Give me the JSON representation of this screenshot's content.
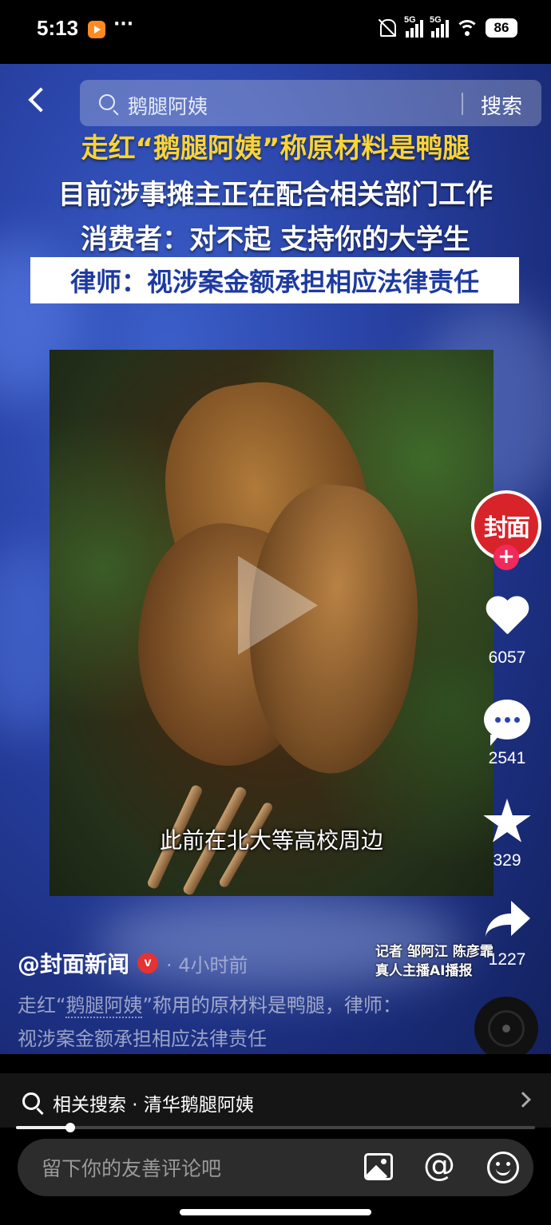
{
  "status_bar": {
    "time": "5:13",
    "dots": "···",
    "signal1_label": "5G",
    "signal2_label": "5G",
    "battery": "86"
  },
  "search": {
    "query": "鹅腿阿姨",
    "button": "搜索"
  },
  "headlines": {
    "line1": "走红“鹅腿阿姨”称原材料是鸭腿",
    "line2": "目前涉事摊主正在配合相关部门工作",
    "line3": "消费者：对不起 支持你的大学生",
    "line4": "律师：视涉案金额承担相应法律责任"
  },
  "video": {
    "subtitle": "此前在北大等高校周边"
  },
  "rail": {
    "avatar_text": "封面",
    "follow": "+",
    "likes": "6057",
    "comments": "2541",
    "favorites": "329",
    "shares": "1227"
  },
  "post": {
    "author": "@封面新闻",
    "verified": "v",
    "time_ago": "· 4小时前",
    "reporter_line1": "记者 邹阿江 陈彦霏",
    "reporter_line2": "真人主播AI播报",
    "desc_prefix": "走红“",
    "desc_keyword": "鹅腿阿姨",
    "desc_suffix": "”称用的原材料是鸭腿，律师：视涉案金额承担相应法律责任"
  },
  "related": {
    "text": "相关搜索 · 清华鹅腿阿姨"
  },
  "playback": {
    "progress": 0.105
  },
  "comment_bar": {
    "placeholder": "留下你的友善评论吧",
    "at": "@"
  },
  "colors": {
    "headline_yellow": "#f9d435",
    "headline_blue": "#1d3aa0",
    "brand_red": "#d8232a",
    "follow_pink": "#f02a5b"
  }
}
